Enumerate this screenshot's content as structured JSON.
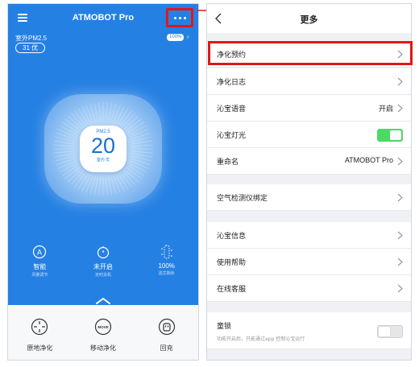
{
  "left_screen": {
    "header": {
      "title": "ATMOBOT Pro",
      "menu_icon": "hamburger-icon",
      "more_icon": "more-dots-icon"
    },
    "outdoor_pm": {
      "label": "室外PM2.5",
      "value": "31 优"
    },
    "battery": {
      "text": "100%",
      "charging_icon": "bolt-icon"
    },
    "dial": {
      "label": "PM2.5",
      "value": "20",
      "sub": "室内 优"
    },
    "status": [
      {
        "icon": "auto-mode-icon",
        "value": "智能",
        "sub": "风量调节"
      },
      {
        "icon": "timer-icon",
        "value": "未开启",
        "sub": "定时关机"
      },
      {
        "icon": "filter-icon",
        "value": "100%",
        "sub": "滤芯剩余"
      }
    ],
    "expand_icon": "chevron-up-icon",
    "bottom_actions": [
      {
        "icon": "spot-purify-icon",
        "label": "原地净化"
      },
      {
        "icon": "move-icon",
        "label": "移动净化",
        "icon_text": "MOVE"
      },
      {
        "icon": "recharge-icon",
        "label": "回充"
      }
    ]
  },
  "right_screen": {
    "header": {
      "title": "更多",
      "back_icon": "back-icon"
    },
    "items": [
      {
        "label": "净化预约"
      },
      {
        "label": "净化日志"
      },
      {
        "label": "沁宝语音",
        "value": "开启"
      },
      {
        "label": "沁宝灯光",
        "toggle": true
      },
      {
        "label": "重命名",
        "value": "ATMOBOT Pro"
      },
      {
        "label": "空气检测仪绑定"
      },
      {
        "label": "沁宝信息"
      },
      {
        "label": "使用帮助"
      },
      {
        "label": "在线客服"
      },
      {
        "label": "童锁",
        "desc": "功能开启后，只能通过app 控制沁宝运行",
        "toggle": false
      }
    ]
  },
  "colors": {
    "primary_blue": "#2580e3",
    "highlight_red": "#e01818",
    "toggle_green": "#4cd964"
  }
}
